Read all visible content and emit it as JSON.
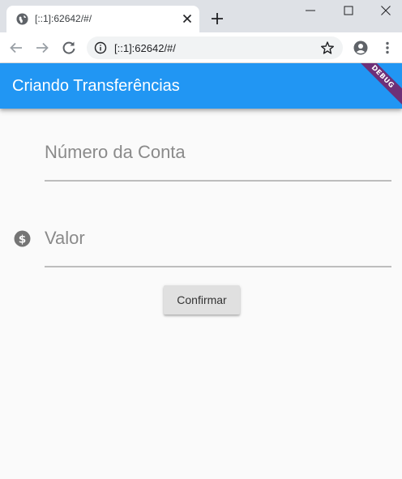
{
  "browser": {
    "tab": {
      "title": "[::1]:62642/#/",
      "favicon": "globe-icon",
      "close_icon": "close-icon"
    },
    "new_tab_icon": "plus-icon",
    "window_controls": [
      "minimize-icon",
      "maximize-icon",
      "close-icon"
    ],
    "toolbar": {
      "back_icon": "arrow-left-icon",
      "forward_icon": "arrow-right-icon",
      "reload_icon": "reload-icon",
      "site_info_icon": "info-icon",
      "url": "[::1]:62642/#/",
      "bookmark_icon": "star-icon",
      "account_icon": "account-circle-icon",
      "menu_icon": "kebab-menu-icon"
    }
  },
  "app": {
    "appbar": {
      "title": "Criando Transferências",
      "color": "#2196f3"
    },
    "debug_banner": "DEBUG",
    "form": {
      "account_field": {
        "label": "Número da Conta",
        "value": ""
      },
      "value_field": {
        "label": "Valor",
        "value": "",
        "icon": "monetization-icon"
      },
      "confirm_button": "Confirmar"
    }
  }
}
